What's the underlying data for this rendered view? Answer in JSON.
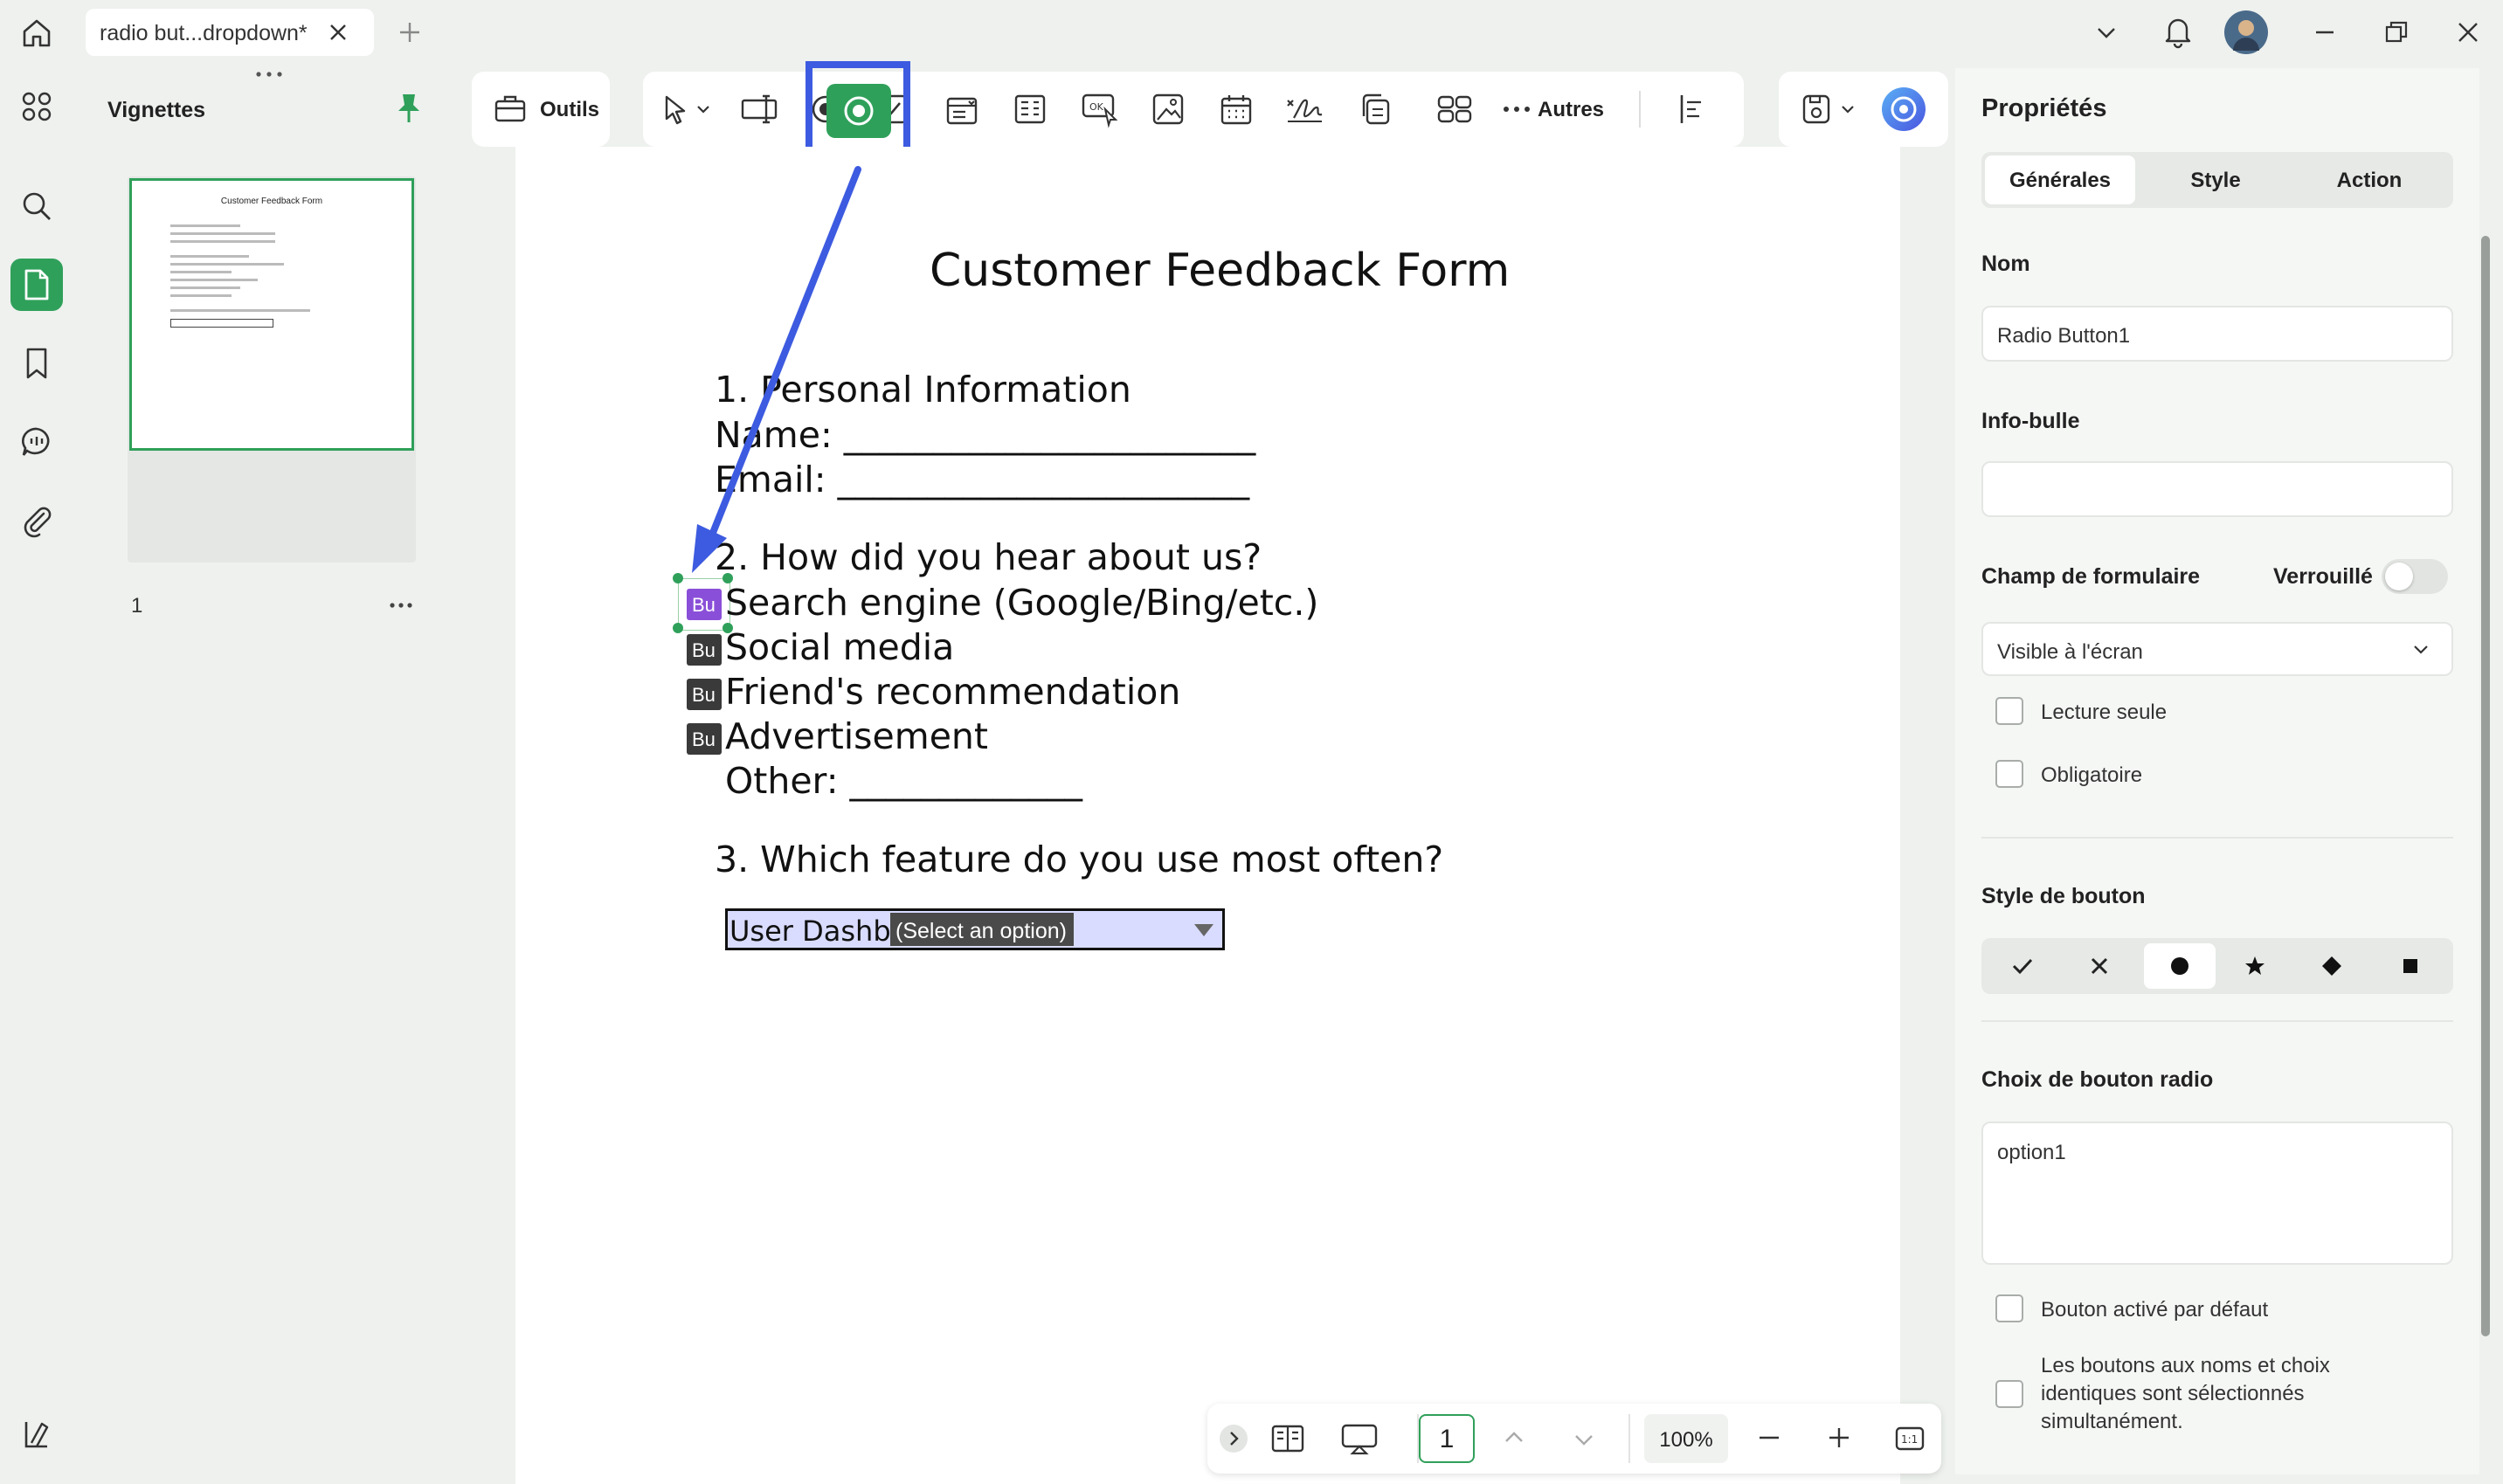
{
  "tab": {
    "title": "radio but...dropdown*"
  },
  "thumbnails": {
    "title": "Vignettes",
    "page_number": "1",
    "mini_title": "Customer Feedback Form"
  },
  "toolbar": {
    "tools_label": "Outils",
    "more_label": "Autres"
  },
  "document": {
    "title": "Customer Feedback Form",
    "section1": "1. Personal Information",
    "name_line": "Name: _______________________",
    "email_line": "Email: _______________________",
    "section2": "2. How did you hear about us?",
    "options": [
      "Search engine (Google/Bing/etc.)",
      "Social media",
      "Friend's recommendation",
      "Advertisement"
    ],
    "radio_tag": "Bu",
    "other_line": "Other: _____________",
    "section3": "3. Which feature do you use most often?",
    "dropdown_value": "User Dashbo",
    "dropdown_placeholder": "(Select an option)"
  },
  "properties": {
    "title": "Propriétés",
    "tabs": [
      "Générales",
      "Style",
      "Action"
    ],
    "name_label": "Nom",
    "name_value": "Radio Button1",
    "tooltip_label": "Info-bulle",
    "tooltip_value": "",
    "form_field_label": "Champ de formulaire",
    "locked_label": "Verrouillé",
    "visibility_value": "Visible à l'écran",
    "readonly_label": "Lecture seule",
    "required_label": "Obligatoire",
    "button_style_label": "Style de bouton",
    "button_styles": [
      "check-icon",
      "cross-icon",
      "circle-icon",
      "star-icon",
      "diamond-icon",
      "square-icon"
    ],
    "radio_choice_label": "Choix de bouton radio",
    "radio_choice_value": "option1",
    "default_on_label": "Bouton activé par défaut",
    "same_name_label_1": "Les boutons aux noms et choix",
    "same_name_label_2": "identiques sont sélectionnés",
    "same_name_label_3": "simultanément."
  },
  "bottom": {
    "page_value": "1",
    "zoom": "100%"
  },
  "colors": {
    "accent": "#2fa05a",
    "highlight": "#3d5be0",
    "radio_selected": "#8a4fd8"
  }
}
